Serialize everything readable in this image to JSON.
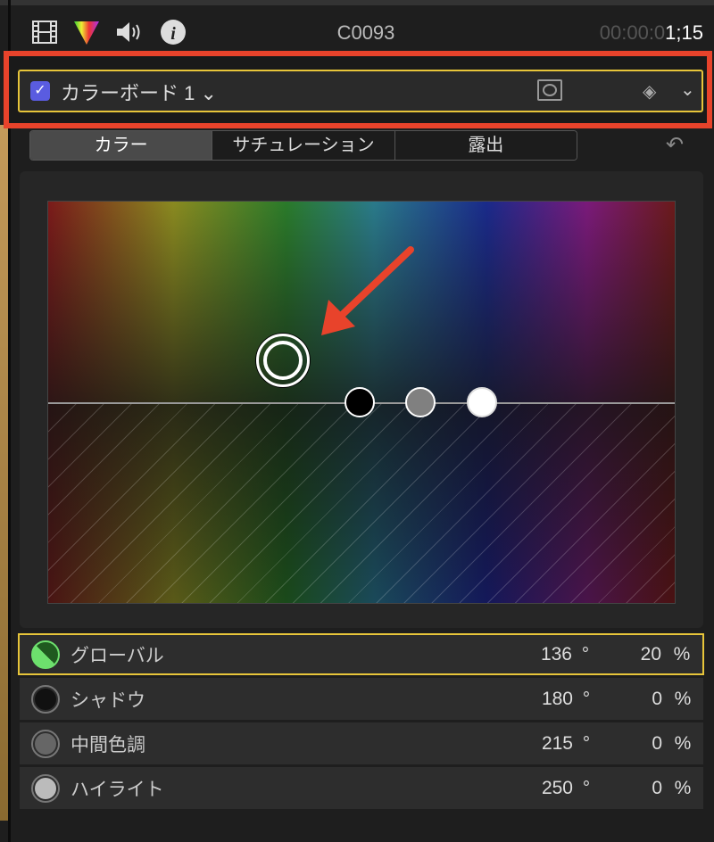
{
  "header": {
    "clip_name": "C0093",
    "timecode_dim": "00:00:0",
    "timecode_bright": "1;15",
    "icons": [
      "film-icon",
      "color-inspector-icon",
      "audio-icon",
      "info-icon"
    ]
  },
  "correction": {
    "enabled": true,
    "check_mark": "✓",
    "name": "カラーボード 1",
    "chevron": "⌄",
    "keyframe_glyph": "◈",
    "expand_glyph": "⌄"
  },
  "tabs": [
    {
      "label": "カラー",
      "active": true
    },
    {
      "label": "サチュレーション"
    },
    {
      "label": "露出"
    }
  ],
  "undo_glyph": "↶",
  "rows": [
    {
      "label": "グローバル",
      "angle": "136",
      "deg": "°",
      "value": "20",
      "unit": "%",
      "selected": true
    },
    {
      "label": "シャドウ",
      "angle": "180",
      "deg": "°",
      "value": "0",
      "unit": "%"
    },
    {
      "label": "中間色調",
      "angle": "215",
      "deg": "°",
      "value": "0",
      "unit": "%"
    },
    {
      "label": "ハイライト",
      "angle": "250",
      "deg": "°",
      "value": "0",
      "unit": "%"
    }
  ],
  "colors": {
    "accent": "#e7c53a",
    "highlight_box": "#e8432b",
    "checkbox": "#5a5ce0",
    "global": "#6de06d"
  }
}
